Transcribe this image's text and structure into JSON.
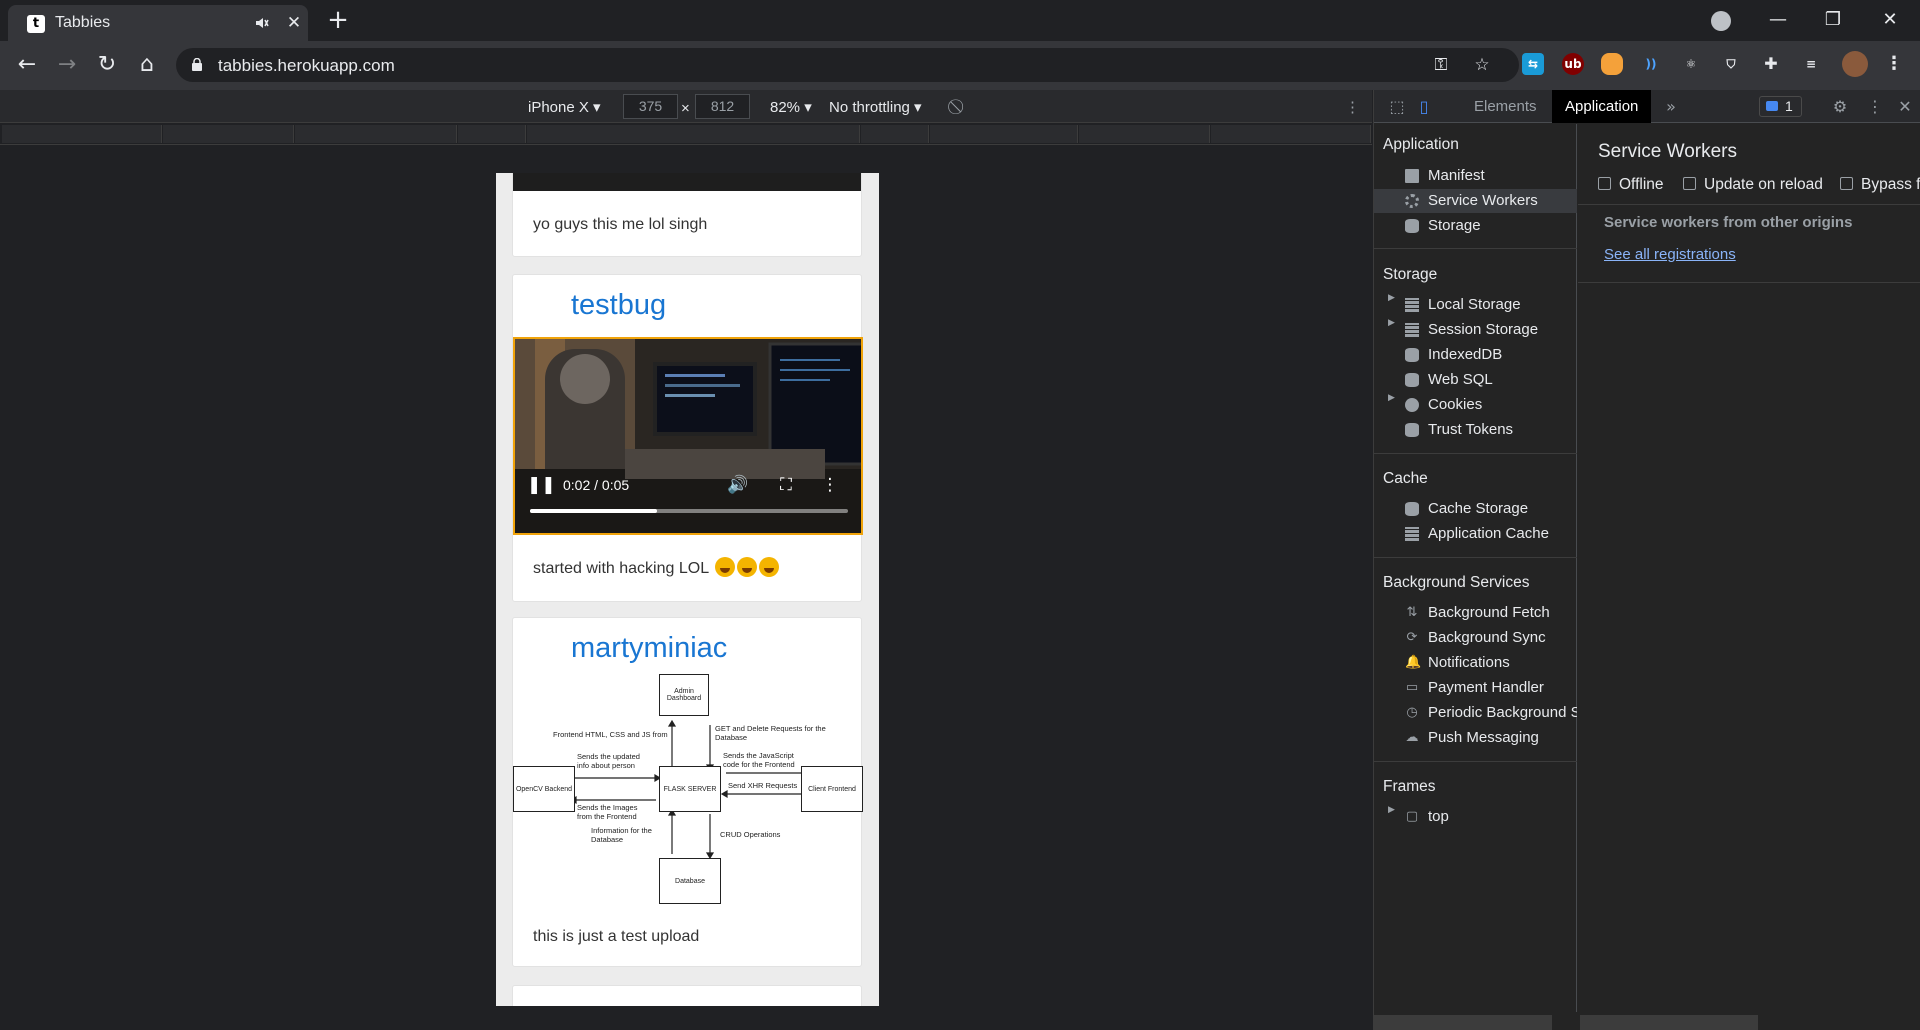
{
  "browser": {
    "tab": {
      "title": "Tabbies",
      "favicon_letter": "t"
    },
    "url": "tabbies.herokuapp.com"
  },
  "device_toolbar": {
    "device": "iPhone X",
    "width": "375",
    "height": "812",
    "times": "×",
    "zoom": "82%",
    "throttling": "No throttling"
  },
  "feed": {
    "cards": [
      {
        "caption": "yo guys this me lol singh"
      },
      {
        "user": "testbug",
        "caption": "started with hacking LOL",
        "video_time": "0:02 / 0:05",
        "video_progress": 0.4
      },
      {
        "user": "martyminiac",
        "caption": "this is just a test upload"
      }
    ],
    "diagram": {
      "boxes": {
        "admin": "Admin Dashboard",
        "flask": "FLASK SERVER",
        "opencv": "OpenCV Backend",
        "client": "Client Frontend",
        "database": "Database"
      },
      "labels": {
        "frontend_html": "Frontend HTML, CSS and JS from",
        "get_delete": "GET and Delete Requests for the Database",
        "sends_updated": "Sends the updated info about person",
        "sends_js": "Sends the JavaScript code for the Frontend",
        "send_xhr": "Send XHR Requests",
        "sends_images": "Sends the Images from the Frontend",
        "info_db": "Information for the Database",
        "crud": "CRUD Operations"
      }
    }
  },
  "devtools": {
    "tabs": {
      "elements": "Elements",
      "application": "Application"
    },
    "issues_count": "1",
    "sidebar": {
      "application": {
        "title": "Application",
        "items": [
          "Manifest",
          "Service Workers",
          "Storage"
        ]
      },
      "storage": {
        "title": "Storage",
        "items": [
          "Local Storage",
          "Session Storage",
          "IndexedDB",
          "Web SQL",
          "Cookies",
          "Trust Tokens"
        ]
      },
      "cache": {
        "title": "Cache",
        "items": [
          "Cache Storage",
          "Application Cache"
        ]
      },
      "background": {
        "title": "Background Services",
        "items": [
          "Background Fetch",
          "Background Sync",
          "Notifications",
          "Payment Handler",
          "Periodic Background S",
          "Push Messaging"
        ]
      },
      "frames": {
        "title": "Frames",
        "items": [
          "top"
        ]
      }
    },
    "service_workers": {
      "title": "Service Workers",
      "options": [
        "Offline",
        "Update on reload",
        "Bypass fo"
      ],
      "other_origins": "Service workers from other origins",
      "see_all": "See all registrations"
    }
  },
  "colors": {
    "accent_link": "#1976d2",
    "video_border": "#f0a30a",
    "devtools_link": "#8ab4f8"
  }
}
